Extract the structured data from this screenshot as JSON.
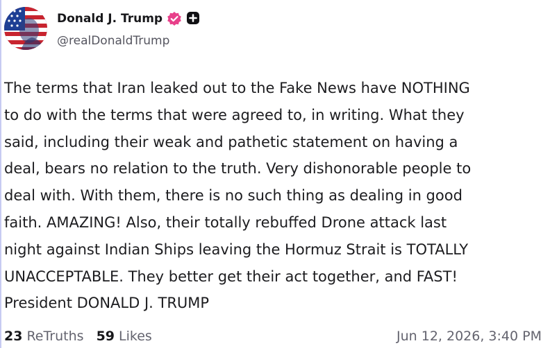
{
  "author": {
    "display_name": "Donald J. Trump",
    "handle": "@realDonaldTrump",
    "avatar_icon": "flag-portrait-avatar",
    "verified_icon": "verified-badge-icon",
    "plus_icon": "plus-badge-icon",
    "verified_color": "#e8408a"
  },
  "post": {
    "text": "The terms that Iran leaked out to the Fake News have NOTHING\nto do with the terms that were agreed to, in writing. What they\nsaid, including their weak and pathetic statement on having a\ndeal, bears no relation to the truth. Very dishonorable people to\ndeal with. With them, there is no such thing as dealing in good\nfaith. AMAZING! Also, their totally rebuffed Drone attack last\nnight against Indian Ships leaving the Hormuz Strait is TOTALLY\nUNACCEPTABLE. They better get their act together, and FAST!\nPresident DONALD J. TRUMP"
  },
  "stats": {
    "retruths_count": "23",
    "retruths_label": "ReTruths",
    "likes_count": "59",
    "likes_label": "Likes"
  },
  "timestamp": "Jun 12, 2026, 3:40 PM"
}
